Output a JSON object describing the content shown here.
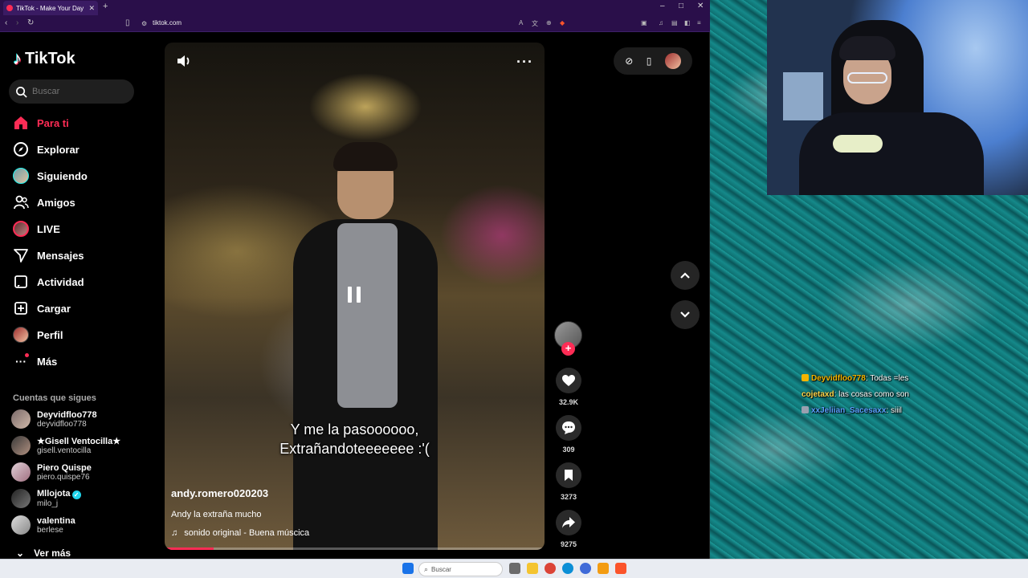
{
  "browser": {
    "tab_title": "TikTok - Make Your Day",
    "tab_close": "✕",
    "new_tab": "+",
    "url": "tiktok.com",
    "window_controls": [
      "–",
      "□",
      "✕"
    ]
  },
  "sidebar": {
    "logo_text": "TikTok",
    "search_placeholder": "Buscar",
    "nav": [
      {
        "label": "Para ti",
        "icon": "home-icon",
        "active": true
      },
      {
        "label": "Explorar",
        "icon": "compass-icon"
      },
      {
        "label": "Siguiendo",
        "icon": "following-avatar-icon"
      },
      {
        "label": "Amigos",
        "icon": "friends-icon"
      },
      {
        "label": "LIVE",
        "icon": "live-avatar-icon"
      },
      {
        "label": "Mensajes",
        "icon": "message-icon"
      },
      {
        "label": "Actividad",
        "icon": "activity-icon"
      },
      {
        "label": "Cargar",
        "icon": "upload-icon"
      },
      {
        "label": "Perfil",
        "icon": "profile-avatar-icon"
      },
      {
        "label": "Más",
        "icon": "more-icon"
      }
    ],
    "following_header": "Cuentas que sigues",
    "following": [
      {
        "name": "Deyvidfloo778",
        "handle": "deyvidfloo778"
      },
      {
        "name": "★Gisell Ventocilla★",
        "handle": "gisell.ventocilla"
      },
      {
        "name": "Piero Quispe",
        "handle": "piero.quispe76"
      },
      {
        "name": "Mllojota",
        "handle": "milo_j",
        "verified": true
      },
      {
        "name": "valentina",
        "handle": "berlese"
      }
    ],
    "see_more": "Ver más"
  },
  "video": {
    "caption_line1": "Y me la pasoooooo,",
    "caption_line2": "Extrañandoteeeeeee :'(",
    "author": "andy.romero020203",
    "description": "Andy la extraña mucho",
    "sound": "sonido original - Buena múscica",
    "progress": 0.13
  },
  "actions": {
    "likes": "32.9K",
    "comments": "309",
    "saves": "3273",
    "shares": "9275"
  },
  "chat": [
    {
      "user": "Deyvidfloo778",
      "text": ": Todas =les"
    },
    {
      "user": "cojetaxd",
      "text": ": las cosas como son"
    },
    {
      "user": "xxJeliian_Sacesaxx",
      "text": ": siiil"
    }
  ],
  "taskbar": {
    "search_placeholder": "Buscar"
  },
  "colors": {
    "accent": "#fe2c55",
    "browser_chrome": "#2a0f4a"
  }
}
